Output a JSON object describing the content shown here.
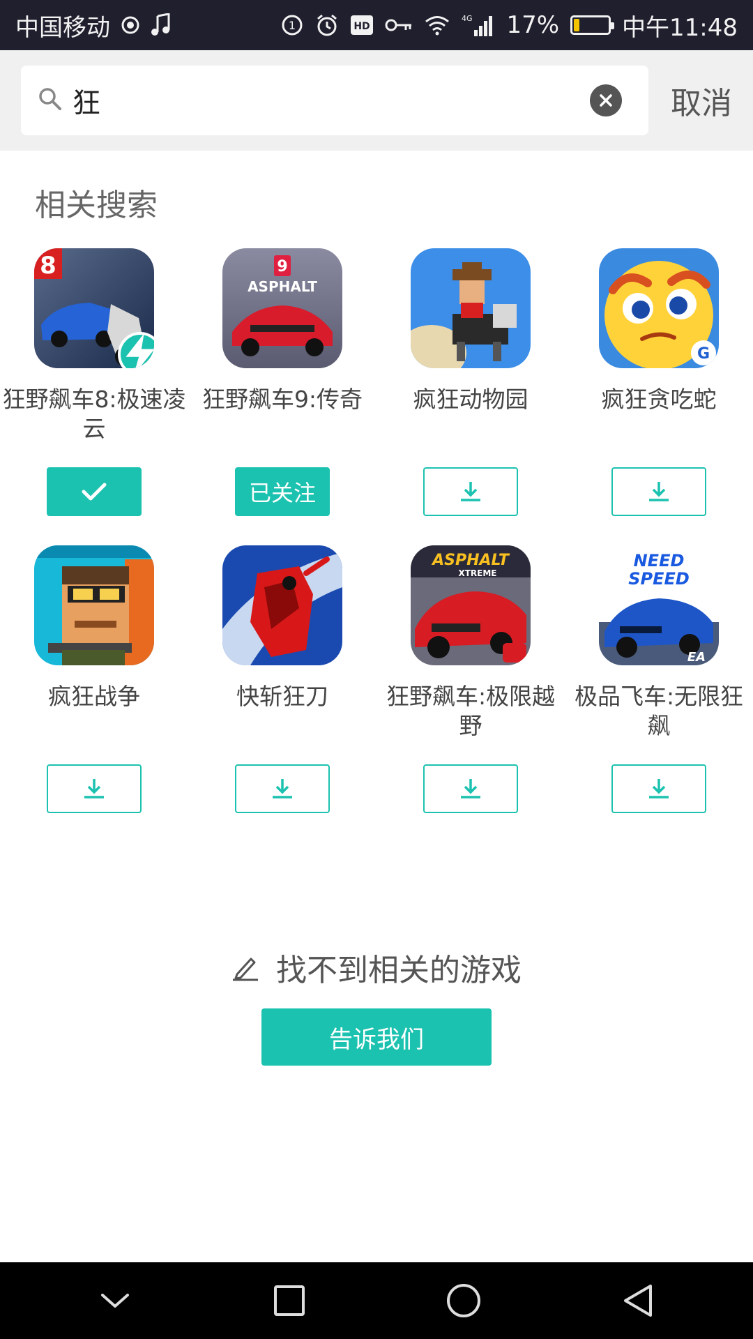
{
  "status_bar": {
    "carrier": "中国移动",
    "network": "4G",
    "battery": "17%",
    "battery_level": 0.17,
    "time": "中午11:48"
  },
  "search": {
    "query": "狂",
    "cancel_label": "取消"
  },
  "section_title": "相关搜索",
  "apps": [
    {
      "name": "狂野飙车8:极速凌云",
      "action": "followed",
      "icon": "asphalt8-icon"
    },
    {
      "name": "狂野飙车9:传奇",
      "action": "followed-text",
      "action_label": "已关注",
      "icon": "asphalt9-icon"
    },
    {
      "name": "疯狂动物园",
      "action": "download",
      "icon": "rodeo-stampede-icon"
    },
    {
      "name": "疯狂贪吃蛇",
      "action": "download",
      "icon": "snake-icon"
    },
    {
      "name": "疯狂战争",
      "action": "download",
      "icon": "blocky-soldier-icon"
    },
    {
      "name": "快斩狂刀",
      "action": "download",
      "icon": "ninja-icon"
    },
    {
      "name": "狂野飙车:极限越野",
      "action": "download",
      "icon": "asphalt-xtreme-icon"
    },
    {
      "name": "极品飞车:无限狂飙",
      "action": "download",
      "icon": "need-for-speed-icon"
    }
  ],
  "not_found": {
    "text": "找不到相关的游戏",
    "button_label": "告诉我们"
  },
  "colors": {
    "accent": "#1cc2b0",
    "status_bg": "#1f1f2e",
    "header_bg": "#f0f0f0"
  }
}
